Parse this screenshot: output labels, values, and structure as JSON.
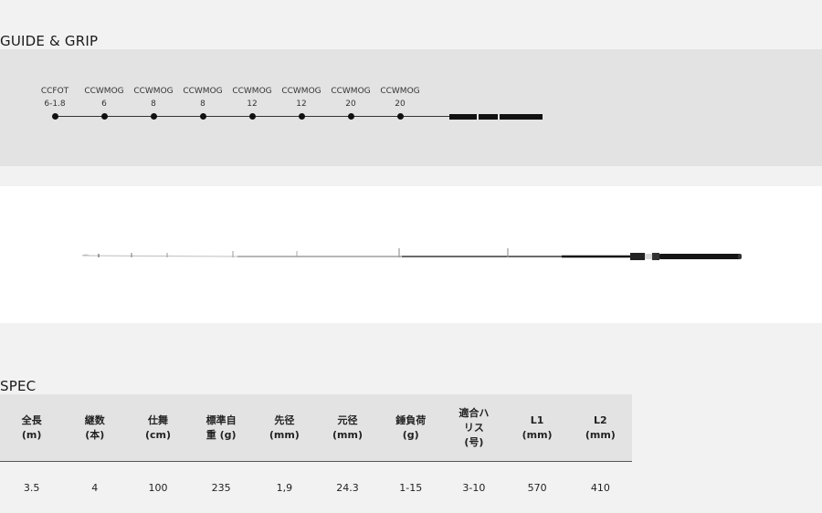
{
  "guide_section": {
    "title": "GUIDE & GRIP",
    "guides": [
      {
        "name": "CCFOT",
        "size": "6-1.8"
      },
      {
        "name": "CCWMOG",
        "size": "6"
      },
      {
        "name": "CCWMOG",
        "size": "8"
      },
      {
        "name": "CCWMOG",
        "size": "8"
      },
      {
        "name": "CCWMOG",
        "size": "12"
      },
      {
        "name": "CCWMOG",
        "size": "12"
      },
      {
        "name": "CCWMOG",
        "size": "20"
      },
      {
        "name": "CCWMOG",
        "size": "20"
      }
    ]
  },
  "rod_image": {
    "icon": "fishing-rod-image"
  },
  "spec_section": {
    "title": "SPEC",
    "headers": [
      "全長\n(m)",
      "継数\n(本)",
      "仕舞\n(cm)",
      "標準自\n重 (g)",
      "先径\n(mm)",
      "元径\n(mm)",
      "錘負荷\n(g)",
      "適合ハ\nリス\n(号)",
      "L1\n(mm)",
      "L2\n(mm)"
    ],
    "rows": [
      [
        "3.5",
        "4",
        "100",
        "235",
        "1,9",
        "24.3",
        "1-15",
        "3-10",
        "570",
        "410"
      ]
    ]
  }
}
